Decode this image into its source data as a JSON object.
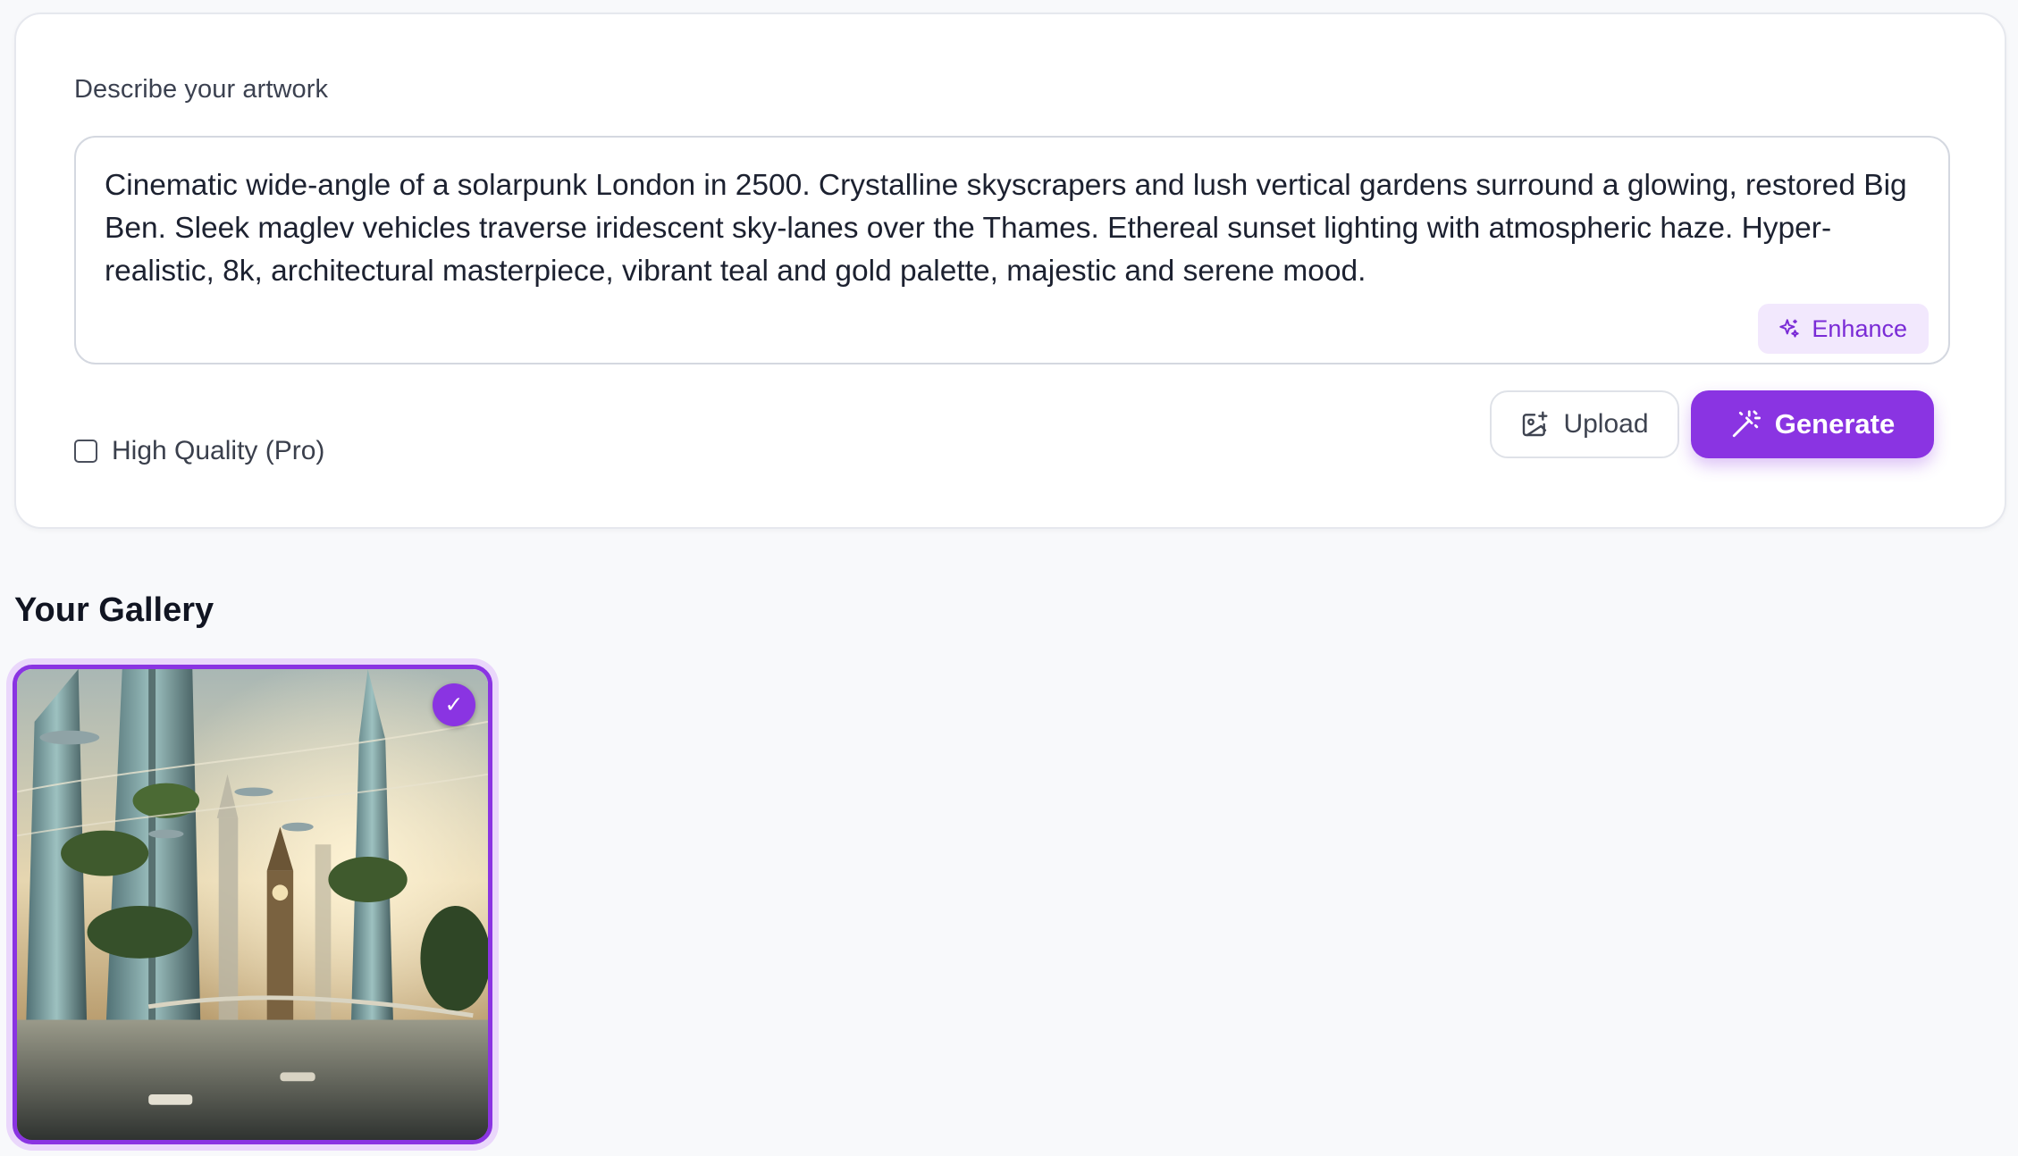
{
  "prompt": {
    "label": "Describe your artwork",
    "value": "Cinematic wide-angle of a solarpunk London in 2500. Crystalline skyscrapers and lush vertical gardens surround a glowing, restored Big Ben. Sleek maglev vehicles traverse iridescent sky-lanes over the Thames. Ethereal sunset lighting with atmospheric haze. Hyper-realistic, 8k, architectural masterpiece, vibrant teal and gold palette, majestic and serene mood.",
    "enhance_label": "Enhance",
    "enhance_icon": "sparkles-icon"
  },
  "options": {
    "high_quality_label": "High Quality (Pro)",
    "high_quality_checked": false
  },
  "actions": {
    "upload_label": "Upload",
    "upload_icon": "image-plus-icon",
    "generate_label": "Generate",
    "generate_icon": "magic-wand-icon"
  },
  "gallery": {
    "title": "Your Gallery",
    "items": [
      {
        "selected": true,
        "selected_mark": "✓"
      }
    ]
  },
  "colors": {
    "accent": "#8a34e2",
    "accent_soft": "#f2e8fd",
    "background": "#f8f9fb",
    "card": "#ffffff"
  }
}
